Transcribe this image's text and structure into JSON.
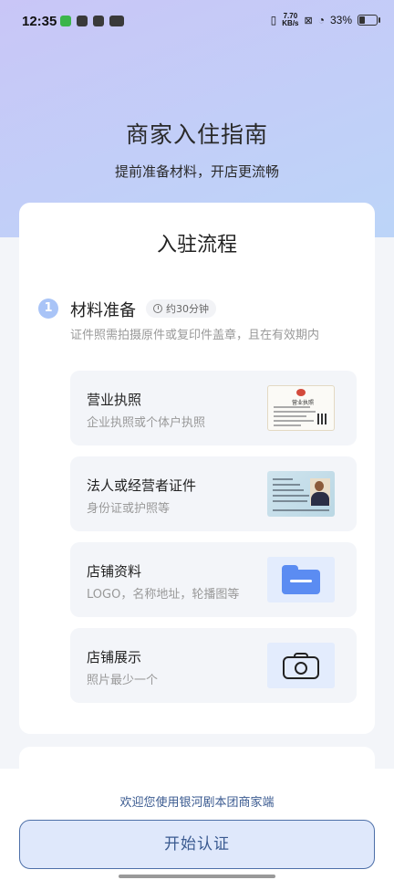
{
  "status_bar": {
    "time": "12:35",
    "net_speed_value": "7.70",
    "net_speed_unit": "KB/s",
    "battery": "33%"
  },
  "hero": {
    "title": "商家入住指南",
    "subtitle": "提前准备材料，开店更流畅"
  },
  "section": {
    "title": "入驻流程"
  },
  "step1": {
    "number": "1",
    "name": "材料准备",
    "duration": "约30分钟",
    "description": "证件照需拍摄原件或复印件盖章，且在有效期内",
    "items": [
      {
        "title": "营业执照",
        "desc": "企业执照或个体户执照",
        "thumb_heading": "营业执照"
      },
      {
        "title": "法人或经营者证件",
        "desc": "身份证或护照等"
      },
      {
        "title": "店铺资料",
        "desc": "LOGO，名称地址，轮播图等",
        "icon": "folder-icon"
      },
      {
        "title": "店铺展示",
        "desc": "照片最少一个",
        "icon": "camera-icon"
      }
    ]
  },
  "footer": {
    "welcome": "欢迎您使用银河剧本团商家端",
    "cta_label": "开始认证"
  },
  "colors": {
    "accent": "#5b8cf2",
    "cta_text": "#3a5a90",
    "cta_bg": "#dfe8fb"
  }
}
